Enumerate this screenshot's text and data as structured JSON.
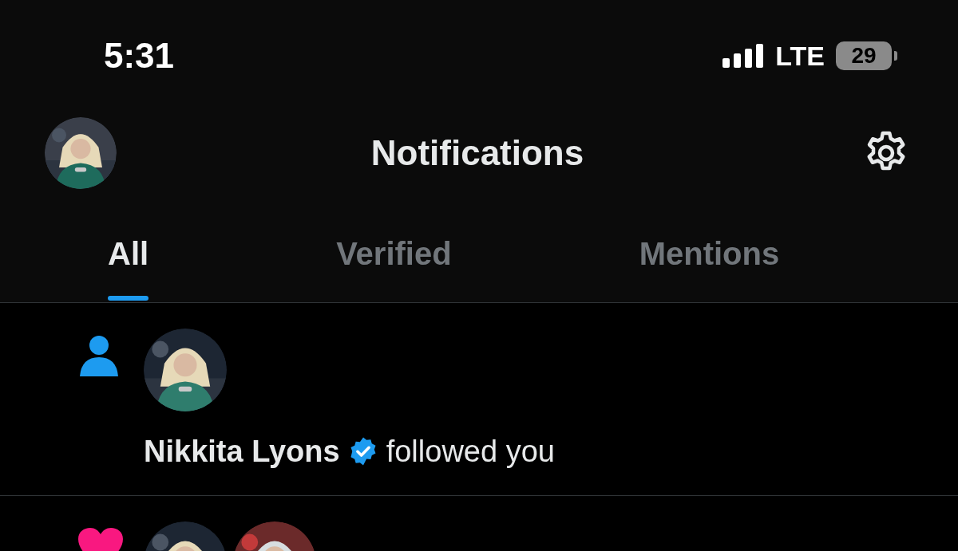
{
  "status_bar": {
    "time": "5:31",
    "network": "LTE",
    "battery": "29"
  },
  "header": {
    "title": "Notifications"
  },
  "tabs": [
    {
      "label": "All",
      "selected": true
    },
    {
      "label": "Verified",
      "selected": false
    },
    {
      "label": "Mentions",
      "selected": false
    }
  ],
  "notifications": [
    {
      "kind": "follow",
      "name": "Nikkita Lyons",
      "verified": true,
      "action": "followed you"
    },
    {
      "kind": "like"
    }
  ]
}
